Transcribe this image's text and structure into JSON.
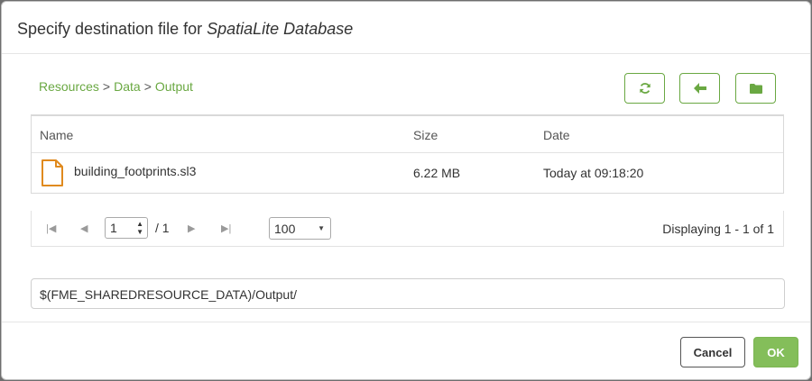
{
  "dialog": {
    "title_prefix": "Specify destination file for ",
    "title_format": "SpatiaLite Database"
  },
  "breadcrumb": {
    "items": [
      "Resources",
      "Data",
      "Output"
    ],
    "separator": ">"
  },
  "toolbar": {
    "refresh_icon": "refresh-icon",
    "back_icon": "arrow-left-icon",
    "new_folder_icon": "folder-icon"
  },
  "table": {
    "columns": [
      "Name",
      "Size",
      "Date"
    ],
    "rows": [
      {
        "name": "building_footprints.sl3",
        "size": "6.22 MB",
        "date": "Today at 09:18:20"
      }
    ]
  },
  "pager": {
    "current_page": "1",
    "total_pages": "/ 1",
    "page_size": "100",
    "displaying": "Displaying 1 - 1 of 1"
  },
  "path": {
    "value": "$(FME_SHAREDRESOURCE_DATA)/Output/"
  },
  "footer": {
    "cancel_label": "Cancel",
    "ok_label": "OK"
  },
  "colors": {
    "accent_green": "#6aa842",
    "ok_button": "#84be5a",
    "file_icon_orange": "#e08a1e"
  }
}
